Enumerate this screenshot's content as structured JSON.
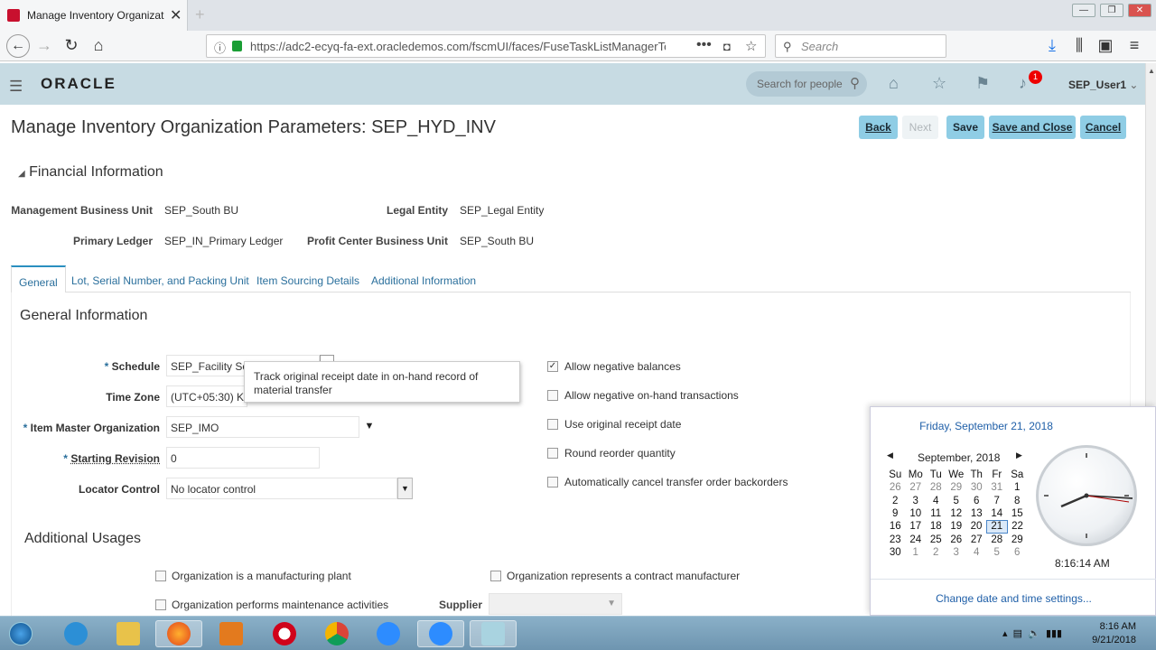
{
  "browser": {
    "tab_title": "Manage Inventory Organizati",
    "url": "https://adc2-ecyq-fa-ext.oracledemos.com/fscmUI/faces/FuseTaskListManagerTo",
    "search_placeholder": "Search"
  },
  "header": {
    "logo": "ORACLE",
    "people_search_placeholder": "Search for people",
    "notification_count": "1",
    "user": "SEP_User1"
  },
  "page": {
    "title": "Manage Inventory Organization Parameters: SEP_HYD_INV",
    "buttons": {
      "back": "Back",
      "next": "Next",
      "save": "Save",
      "save_close": "Save and Close",
      "cancel": "Cancel"
    },
    "financial": {
      "heading": "Financial Information",
      "mbu_label": "Management Business Unit",
      "mbu_value": "SEP_South BU",
      "le_label": "Legal Entity",
      "le_value": "SEP_Legal Entity",
      "pl_label": "Primary Ledger",
      "pl_value": "SEP_IN_Primary Ledger",
      "pcbu_label": "Profit Center Business Unit",
      "pcbu_value": "SEP_South BU"
    },
    "tabs": [
      "General",
      "Lot, Serial Number, and Packing Unit",
      "Item Sourcing Details",
      "Additional Information"
    ],
    "general": {
      "heading": "General Information",
      "schedule_label": "Schedule",
      "schedule_value": "SEP_Facility Sc",
      "timezone_label": "Time Zone",
      "timezone_value": "(UTC+05:30) Ko",
      "imo_label": "Item Master Organization",
      "imo_value": "SEP_IMO",
      "rev_label": "Starting Revision",
      "rev_value": "0",
      "locator_label": "Locator Control",
      "locator_value": "No locator control",
      "checkboxes": [
        {
          "label": "Allow negative balances",
          "checked": true
        },
        {
          "label": "Allow negative on-hand transactions",
          "checked": false
        },
        {
          "label": "Use original receipt date",
          "checked": false
        },
        {
          "label": "Round reorder quantity",
          "checked": false
        },
        {
          "label": "Automatically cancel transfer order backorders",
          "checked": false
        }
      ],
      "tooltip": "Track original receipt date in on-hand record of material transfer"
    },
    "usages": {
      "heading": "Additional Usages",
      "mfg": "Organization is a manufacturing plant",
      "contract": "Organization represents a contract manufacturer",
      "maint": "Organization performs maintenance activities",
      "supplier_label": "Supplier"
    }
  },
  "calendar": {
    "full_date": "Friday, September 21, 2018",
    "month": "September, 2018",
    "weekdays": [
      "Su",
      "Mo",
      "Tu",
      "We",
      "Th",
      "Fr",
      "Sa"
    ],
    "weeks": [
      [
        "26",
        "27",
        "28",
        "29",
        "30",
        "31",
        "1"
      ],
      [
        "2",
        "3",
        "4",
        "5",
        "6",
        "7",
        "8"
      ],
      [
        "9",
        "10",
        "11",
        "12",
        "13",
        "14",
        "15"
      ],
      [
        "16",
        "17",
        "18",
        "19",
        "20",
        "21",
        "22"
      ],
      [
        "23",
        "24",
        "25",
        "26",
        "27",
        "28",
        "29"
      ],
      [
        "30",
        "1",
        "2",
        "3",
        "4",
        "5",
        "6"
      ]
    ],
    "selected": "21",
    "time": "8:16:14 AM",
    "link": "Change date and time settings..."
  },
  "taskbar": {
    "time": "8:16 AM",
    "date": "9/21/2018"
  }
}
